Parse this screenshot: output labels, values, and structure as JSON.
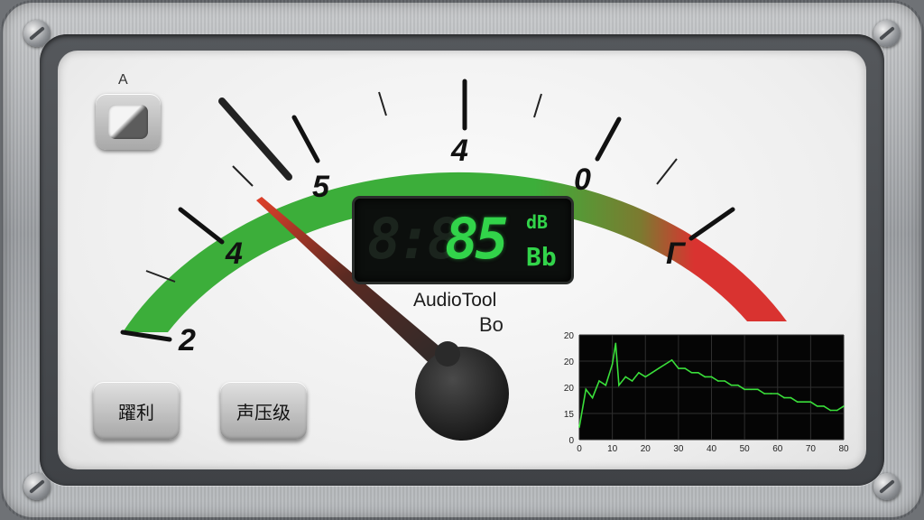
{
  "mode": {
    "label": "A"
  },
  "gauge": {
    "scale_labels": [
      "2",
      "4",
      "5",
      "4",
      "0",
      "Γ"
    ]
  },
  "lcd": {
    "ghost": "8:8",
    "value": "85",
    "unit_top": "dB",
    "unit_bottom": "Bb"
  },
  "brand": {
    "name": "AudioTool",
    "sub": "Bo"
  },
  "buttons": {
    "left_label": "躍利",
    "right_label": "声压级"
  },
  "colors": {
    "green": "#3cae3a",
    "red": "#d93330",
    "lcd_green": "#32d44a"
  },
  "chart_data": {
    "type": "line",
    "title": "",
    "xlabel": "",
    "ylabel": "",
    "x_ticks": [
      "0",
      "10",
      "20",
      "30",
      "40",
      "50",
      "60",
      "70",
      "80"
    ],
    "y_ticks": [
      "20",
      "20",
      "20",
      "15",
      "0"
    ],
    "xlim": [
      0,
      80
    ],
    "grid": true,
    "series": [
      {
        "x": [
          0,
          2,
          4,
          6,
          8,
          10,
          11,
          12,
          14,
          16,
          18,
          20,
          22,
          24,
          26,
          28,
          30,
          32,
          34,
          36,
          38,
          40,
          42,
          44,
          46,
          48,
          50,
          52,
          54,
          56,
          58,
          60,
          62,
          64,
          66,
          68,
          70,
          72,
          74,
          76,
          78,
          80
        ],
        "y": [
          3,
          12,
          10,
          14,
          13,
          18,
          23,
          13,
          15,
          14,
          16,
          15,
          16,
          17,
          18,
          19,
          17,
          17,
          16,
          16,
          15,
          15,
          14,
          14,
          13,
          13,
          12,
          12,
          12,
          11,
          11,
          11,
          10,
          10,
          9,
          9,
          9,
          8,
          8,
          7,
          7,
          8
        ]
      }
    ]
  }
}
